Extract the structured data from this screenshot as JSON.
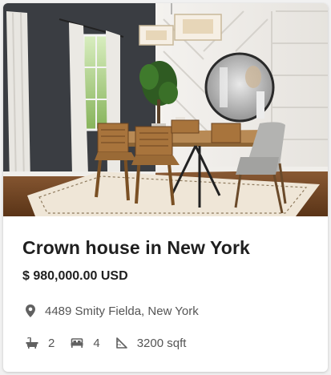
{
  "listing": {
    "title": "Crown house in New York",
    "price": "$ 980,000.00 USD",
    "address": "4489 Smity Fielda, New York",
    "features": {
      "bathrooms": "2",
      "bedrooms": "4",
      "area": "3200 sqft"
    }
  },
  "icons": {
    "location": "location-pin-icon",
    "bath": "bathtub-icon",
    "bed": "bed-icon",
    "area": "ruler-triangle-icon"
  },
  "colors": {
    "title": "#1f1f1f",
    "text_muted": "#555555",
    "icon": "#616161",
    "card_bg": "#ffffff",
    "page_bg": "#f1f1f1"
  }
}
